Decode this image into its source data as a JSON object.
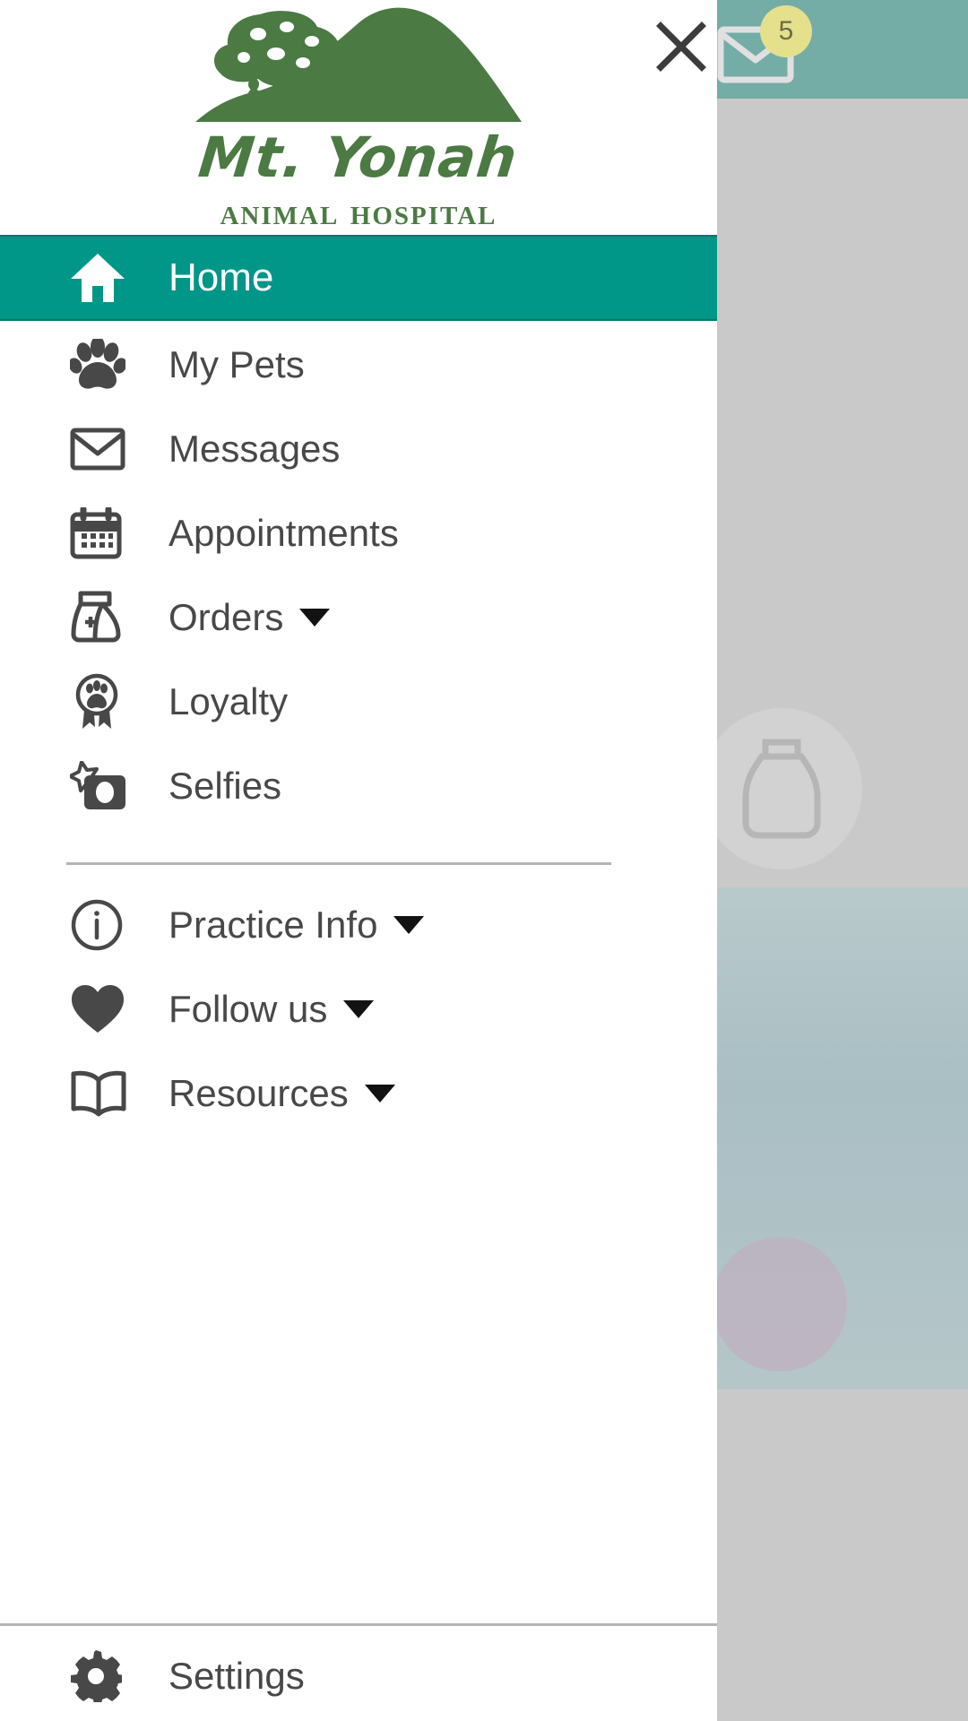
{
  "background": {
    "mail_icon": "mail-icon",
    "mail_badge_count": "5",
    "jug_icon": "water-jug-icon"
  },
  "drawer": {
    "close_label": "close-icon",
    "logo": {
      "mark": "mountain-tree-logo",
      "name": "Mt. Yonah",
      "subtitle": "Animal Hospital"
    },
    "primary_items": [
      {
        "id": "home",
        "label": "Home",
        "icon": "home-icon",
        "active": true,
        "has_caret": false
      },
      {
        "id": "my-pets",
        "label": "My Pets",
        "icon": "paw-icon",
        "active": false,
        "has_caret": false
      },
      {
        "id": "messages",
        "label": "Messages",
        "icon": "envelope-icon",
        "active": false,
        "has_caret": false
      },
      {
        "id": "appointments",
        "label": "Appointments",
        "icon": "calendar-icon",
        "active": false,
        "has_caret": false
      },
      {
        "id": "orders",
        "label": "Orders",
        "icon": "food-bag-icon",
        "active": false,
        "has_caret": true
      },
      {
        "id": "loyalty",
        "label": "Loyalty",
        "icon": "award-paw-icon",
        "active": false,
        "has_caret": false
      },
      {
        "id": "selfies",
        "label": "Selfies",
        "icon": "camera-star-icon",
        "active": false,
        "has_caret": false
      }
    ],
    "secondary_items": [
      {
        "id": "practice-info",
        "label": "Practice Info",
        "icon": "info-circle-icon",
        "has_caret": true
      },
      {
        "id": "follow-us",
        "label": "Follow us",
        "icon": "heart-icon",
        "has_caret": true
      },
      {
        "id": "resources",
        "label": "Resources",
        "icon": "book-icon",
        "has_caret": true
      }
    ],
    "footer_items": [
      {
        "id": "settings",
        "label": "Settings",
        "icon": "gear-icon",
        "has_caret": false
      }
    ]
  },
  "colors": {
    "accent_teal": "#009688",
    "accent_teal_border": "#00796b",
    "logo_green": "#4b7a43",
    "text_gray": "#484848",
    "badge_yellow": "#e4e08b",
    "divider_gray": "#b5b5b5"
  }
}
